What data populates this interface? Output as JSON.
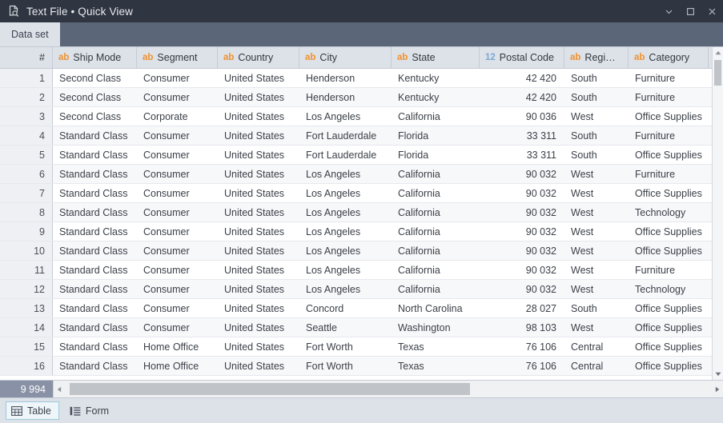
{
  "titlebar": {
    "icon": "document-search-icon",
    "title": "Text File • Quick View",
    "minimize_label": "minimize-icon",
    "maximize_label": "maximize-icon",
    "close_label": "close-icon"
  },
  "tabs": [
    {
      "label": "Data set",
      "active": true
    }
  ],
  "table": {
    "row_number_header": "#",
    "columns": [
      {
        "label": "Ship Mode",
        "type": "ab"
      },
      {
        "label": "Segment",
        "type": "ab"
      },
      {
        "label": "Country",
        "type": "ab"
      },
      {
        "label": "City",
        "type": "ab"
      },
      {
        "label": "State",
        "type": "ab"
      },
      {
        "label": "Postal Code",
        "type": "12"
      },
      {
        "label": "Regi…",
        "type": "ab"
      },
      {
        "label": "Category",
        "type": "ab"
      }
    ],
    "rows": [
      {
        "n": "1",
        "ship": "Second Class",
        "seg": "Consumer",
        "country": "United States",
        "city": "Henderson",
        "state": "Kentucky",
        "postal": "42 420",
        "region": "South",
        "cat": "Furniture"
      },
      {
        "n": "2",
        "ship": "Second Class",
        "seg": "Consumer",
        "country": "United States",
        "city": "Henderson",
        "state": "Kentucky",
        "postal": "42 420",
        "region": "South",
        "cat": "Furniture"
      },
      {
        "n": "3",
        "ship": "Second Class",
        "seg": "Corporate",
        "country": "United States",
        "city": "Los Angeles",
        "state": "California",
        "postal": "90 036",
        "region": "West",
        "cat": "Office Supplies"
      },
      {
        "n": "4",
        "ship": "Standard Class",
        "seg": "Consumer",
        "country": "United States",
        "city": "Fort Lauderdale",
        "state": "Florida",
        "postal": "33 311",
        "region": "South",
        "cat": "Furniture"
      },
      {
        "n": "5",
        "ship": "Standard Class",
        "seg": "Consumer",
        "country": "United States",
        "city": "Fort Lauderdale",
        "state": "Florida",
        "postal": "33 311",
        "region": "South",
        "cat": "Office Supplies"
      },
      {
        "n": "6",
        "ship": "Standard Class",
        "seg": "Consumer",
        "country": "United States",
        "city": "Los Angeles",
        "state": "California",
        "postal": "90 032",
        "region": "West",
        "cat": "Furniture"
      },
      {
        "n": "7",
        "ship": "Standard Class",
        "seg": "Consumer",
        "country": "United States",
        "city": "Los Angeles",
        "state": "California",
        "postal": "90 032",
        "region": "West",
        "cat": "Office Supplies"
      },
      {
        "n": "8",
        "ship": "Standard Class",
        "seg": "Consumer",
        "country": "United States",
        "city": "Los Angeles",
        "state": "California",
        "postal": "90 032",
        "region": "West",
        "cat": "Technology"
      },
      {
        "n": "9",
        "ship": "Standard Class",
        "seg": "Consumer",
        "country": "United States",
        "city": "Los Angeles",
        "state": "California",
        "postal": "90 032",
        "region": "West",
        "cat": "Office Supplies"
      },
      {
        "n": "10",
        "ship": "Standard Class",
        "seg": "Consumer",
        "country": "United States",
        "city": "Los Angeles",
        "state": "California",
        "postal": "90 032",
        "region": "West",
        "cat": "Office Supplies"
      },
      {
        "n": "11",
        "ship": "Standard Class",
        "seg": "Consumer",
        "country": "United States",
        "city": "Los Angeles",
        "state": "California",
        "postal": "90 032",
        "region": "West",
        "cat": "Furniture"
      },
      {
        "n": "12",
        "ship": "Standard Class",
        "seg": "Consumer",
        "country": "United States",
        "city": "Los Angeles",
        "state": "California",
        "postal": "90 032",
        "region": "West",
        "cat": "Technology"
      },
      {
        "n": "13",
        "ship": "Standard Class",
        "seg": "Consumer",
        "country": "United States",
        "city": "Concord",
        "state": "North Carolina",
        "postal": "28 027",
        "region": "South",
        "cat": "Office Supplies"
      },
      {
        "n": "14",
        "ship": "Standard Class",
        "seg": "Consumer",
        "country": "United States",
        "city": "Seattle",
        "state": "Washington",
        "postal": "98 103",
        "region": "West",
        "cat": "Office Supplies"
      },
      {
        "n": "15",
        "ship": "Standard Class",
        "seg": "Home Office",
        "country": "United States",
        "city": "Fort Worth",
        "state": "Texas",
        "postal": "76 106",
        "region": "Central",
        "cat": "Office Supplies"
      },
      {
        "n": "16",
        "ship": "Standard Class",
        "seg": "Home Office",
        "country": "United States",
        "city": "Fort Worth",
        "state": "Texas",
        "postal": "76 106",
        "region": "Central",
        "cat": "Office Supplies"
      }
    ],
    "total_rows": "9 994"
  },
  "bottombar": {
    "buttons": [
      {
        "label": "Table",
        "icon": "table-grid-icon",
        "active": true
      },
      {
        "label": "Form",
        "icon": "form-list-icon",
        "active": false
      }
    ]
  },
  "colors": {
    "titlebar_bg": "#2f3541",
    "tabstrip_bg": "#5c6679",
    "header_bg": "#dde1e8",
    "type_text": "#f0912d",
    "type_number": "#7aa8d6",
    "total_bg": "#8891a5",
    "active_btn_border": "#9ec9dd"
  }
}
